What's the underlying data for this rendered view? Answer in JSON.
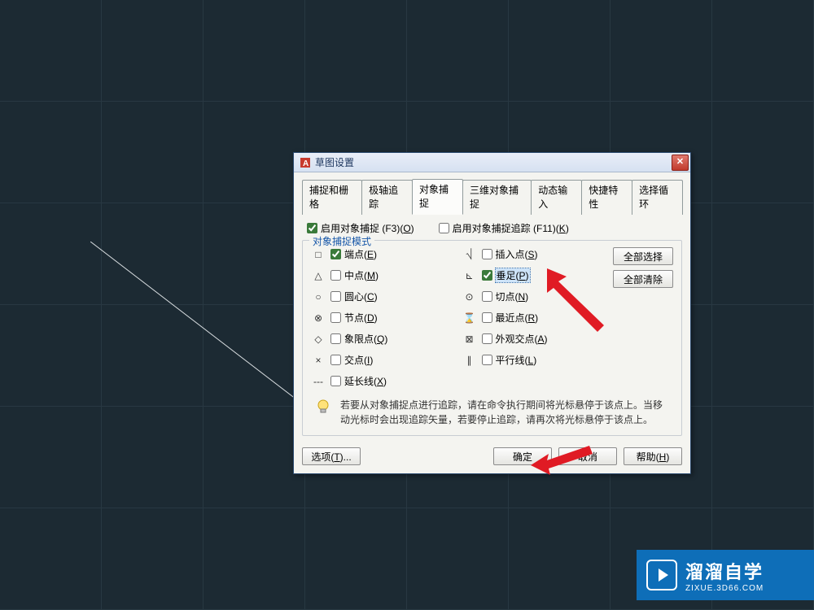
{
  "dialog": {
    "title": "草图设置",
    "tabs": [
      "捕捉和栅格",
      "极轴追踪",
      "对象捕捉",
      "三维对象捕捉",
      "动态输入",
      "快捷特性",
      "选择循环"
    ],
    "active_tab_index": 2,
    "enable_osnap": {
      "label": "启用对象捕捉 (F3)(",
      "hotkey": "O",
      "suffix": ")",
      "checked": true
    },
    "enable_otrack": {
      "label": "启用对象捕捉追踪 (F11)(",
      "hotkey": "K",
      "suffix": ")",
      "checked": false
    },
    "fieldset_title": "对象捕捉模式",
    "left_col": [
      {
        "sym": "□",
        "label": "端点(",
        "hot": "E",
        "suf": ")",
        "checked": true
      },
      {
        "sym": "△",
        "label": "中点(",
        "hot": "M",
        "suf": ")",
        "checked": false
      },
      {
        "sym": "○",
        "label": "圆心(",
        "hot": "C",
        "suf": ")",
        "checked": false
      },
      {
        "sym": "⊗",
        "label": "节点(",
        "hot": "D",
        "suf": ")",
        "checked": false
      },
      {
        "sym": "◇",
        "label": "象限点(",
        "hot": "Q",
        "suf": ")",
        "checked": false
      },
      {
        "sym": "×",
        "label": "交点(",
        "hot": "I",
        "suf": ")",
        "checked": false
      },
      {
        "sym": "---",
        "label": "延长线(",
        "hot": "X",
        "suf": ")",
        "checked": false
      }
    ],
    "right_col": [
      {
        "sym": "⎷",
        "label": "插入点(",
        "hot": "S",
        "suf": ")",
        "checked": false
      },
      {
        "sym": "⊾",
        "label": "垂足(",
        "hot": "P",
        "suf": ")",
        "checked": true,
        "highlight": true
      },
      {
        "sym": "⊙",
        "label": "切点(",
        "hot": "N",
        "suf": ")",
        "checked": false
      },
      {
        "sym": "⌛",
        "label": "最近点(",
        "hot": "R",
        "suf": ")",
        "checked": false
      },
      {
        "sym": "⊠",
        "label": "外观交点(",
        "hot": "A",
        "suf": ")",
        "checked": false
      },
      {
        "sym": "∥",
        "label": "平行线(",
        "hot": "L",
        "suf": ")",
        "checked": false
      }
    ],
    "select_all": "全部选择",
    "clear_all": "全部清除",
    "hint": "若要从对象捕捉点进行追踪，请在命令执行期间将光标悬停于该点上。当移动光标时会出现追踪矢量，若要停止追踪，请再次将光标悬停于该点上。",
    "options_btn": {
      "label": "选项(",
      "hot": "T",
      "suf": ")..."
    },
    "ok": "确定",
    "cancel": "取消",
    "help": {
      "label": "帮助(",
      "hot": "H",
      "suf": ")"
    }
  },
  "watermark": {
    "main": "溜溜自学",
    "sub": "ZIXUE.3D66.COM"
  }
}
